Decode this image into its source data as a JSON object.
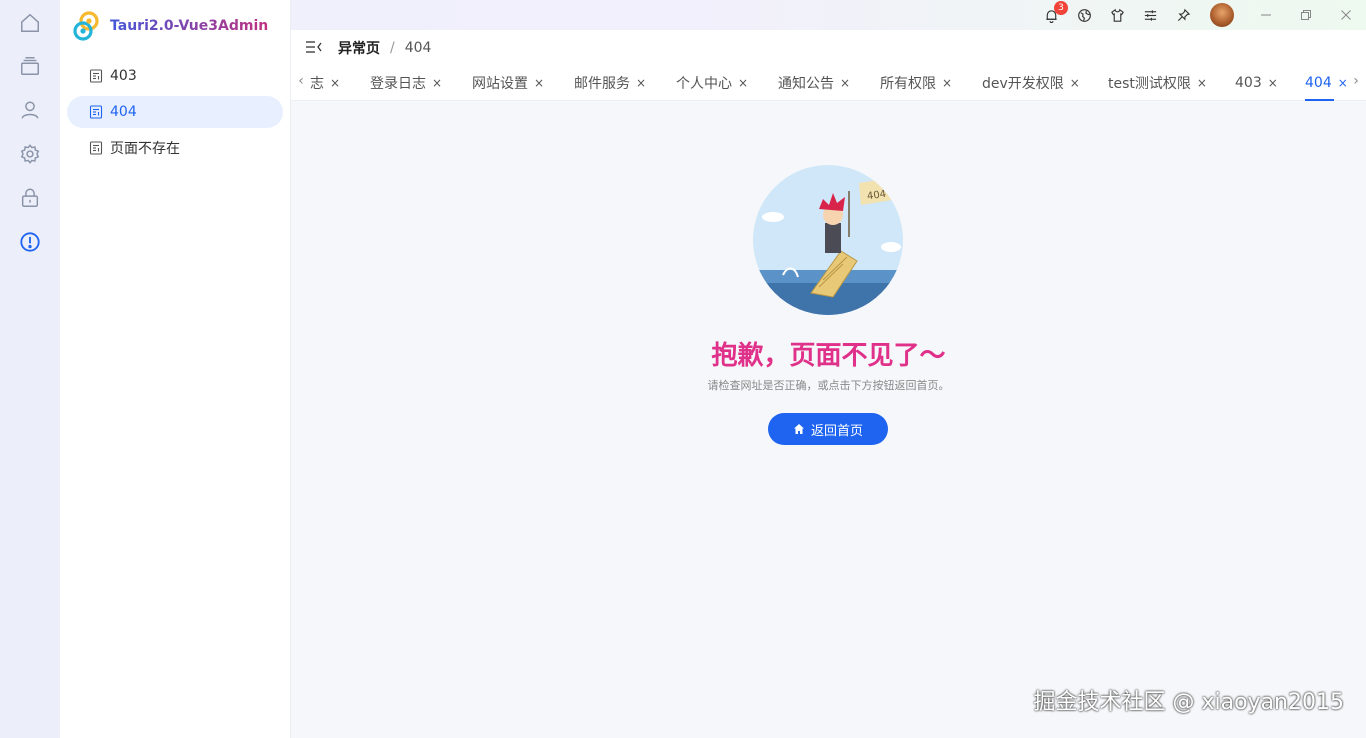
{
  "app": {
    "title": "Tauri2.0-Vue3Admin"
  },
  "rail": {
    "icons": [
      "home-icon",
      "layers-icon",
      "user-icon",
      "gear-icon",
      "lock-icon",
      "alert-icon"
    ]
  },
  "sidebar": {
    "items": [
      {
        "label": "403",
        "active": false
      },
      {
        "label": "404",
        "active": true
      },
      {
        "label": "页面不存在",
        "active": false
      }
    ]
  },
  "topbar": {
    "notification_count": "3"
  },
  "breadcrumb": {
    "parent": "异常页",
    "separator": "/",
    "current": "404"
  },
  "tabs": [
    {
      "label": "志"
    },
    {
      "label": "登录日志"
    },
    {
      "label": "网站设置"
    },
    {
      "label": "邮件服务"
    },
    {
      "label": "个人中心"
    },
    {
      "label": "通知公告"
    },
    {
      "label": "所有权限"
    },
    {
      "label": "dev开发权限"
    },
    {
      "label": "test测试权限"
    },
    {
      "label": "403"
    },
    {
      "label": "404",
      "active": true
    }
  ],
  "tab_close_glyph": "×",
  "error": {
    "code": "404",
    "title": "抱歉，页面不见了～",
    "subtitle": "请检查网址是否正确，或点击下方按钮返回首页。",
    "button_label": "返回首页"
  },
  "watermark": "掘金技术社区 @ xiaoyan2015",
  "colors": {
    "accent": "#1e64f0",
    "title_pink": "#e0318a",
    "badge_red": "#f0443a"
  }
}
